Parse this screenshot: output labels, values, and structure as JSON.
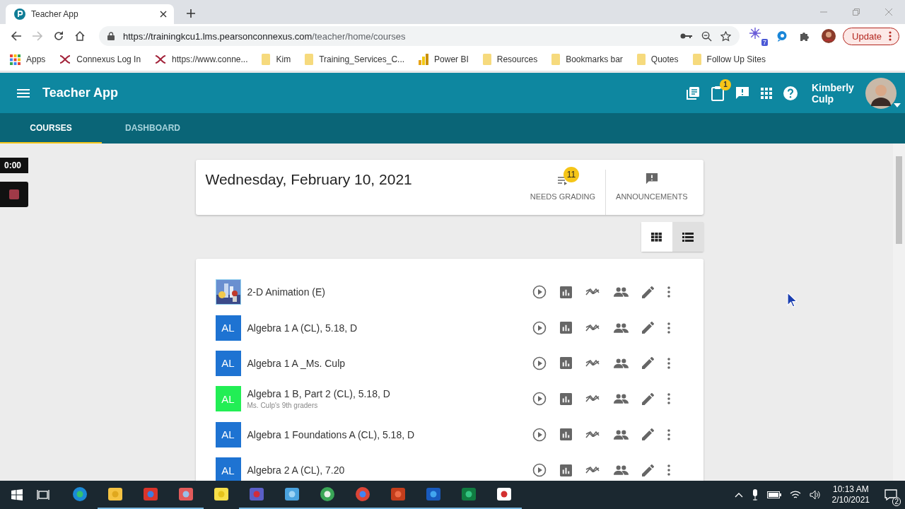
{
  "browser": {
    "tab_title": "Teacher App",
    "url": {
      "host": "https://trainingkcu1.lms.pearsonconnexus.com",
      "path": "/teacher/home/courses"
    },
    "extension_badge": "7",
    "update_button": "Update",
    "bookmarks": [
      {
        "kind": "apps",
        "label": "Apps"
      },
      {
        "kind": "connexus",
        "label": "Connexus Log In"
      },
      {
        "kind": "connexus",
        "label": "https://www.conne..."
      },
      {
        "kind": "folder",
        "label": "Kim"
      },
      {
        "kind": "folder",
        "label": "Training_Services_C..."
      },
      {
        "kind": "powerbi",
        "label": "Power BI"
      },
      {
        "kind": "folder",
        "label": "Resources"
      },
      {
        "kind": "folder",
        "label": "Bookmarks bar"
      },
      {
        "kind": "folder",
        "label": "Quotes"
      },
      {
        "kind": "folder",
        "label": "Follow Up Sites"
      }
    ]
  },
  "app": {
    "title": "Teacher App",
    "notification_badge": "1",
    "user_name": "Kimberly Culp",
    "nav_tabs": [
      {
        "label": "COURSES",
        "selected": true
      },
      {
        "label": "DASHBOARD",
        "selected": false
      }
    ]
  },
  "recorder": {
    "time": "0:00"
  },
  "summary": {
    "date": "Wednesday, February 10, 2021",
    "needs_grading": {
      "count": "11",
      "label": "NEEDS GRADING"
    },
    "announcements": {
      "label": "ANNOUNCEMENTS"
    }
  },
  "view_toggle": [
    {
      "kind": "grid",
      "selected": false
    },
    {
      "kind": "list",
      "selected": true
    }
  ],
  "courses": [
    {
      "name": "2-D Animation (E)"
    },
    {
      "name": "Algebra 1 A (CL), 5.18, D",
      "thumb": {
        "kind": "initials",
        "text": "AL",
        "color": "#1e73d2"
      }
    },
    {
      "name": "Algebra 1 A _Ms. Culp",
      "thumb": {
        "kind": "initials",
        "text": "AL",
        "color": "#1e73d2"
      }
    },
    {
      "name": "Algebra 1 B, Part 2 (CL), 5.18, D",
      "subtitle": "Ms. Culp's 9th graders",
      "thumb": {
        "kind": "initials",
        "text": "AL",
        "color": "#22ee55"
      }
    },
    {
      "name": "Algebra 1 Foundations A (CL), 5.18, D",
      "thumb": {
        "kind": "initials",
        "text": "AL",
        "color": "#1e73d2"
      }
    },
    {
      "name": "Algebra 2 A (CL), 7.20",
      "thumb": {
        "kind": "initials",
        "text": "AL",
        "color": "#1e73d2"
      }
    }
  ],
  "taskbar": {
    "apps": [
      {
        "kind": "edge",
        "running": false
      },
      {
        "kind": "folder",
        "running": true
      },
      {
        "kind": "snip",
        "running": true
      },
      {
        "kind": "sketch",
        "running": true
      },
      {
        "kind": "notes",
        "running": false
      },
      {
        "kind": "teams",
        "running": true
      },
      {
        "kind": "photos",
        "running": true
      },
      {
        "kind": "globe",
        "running": true
      },
      {
        "kind": "chrome",
        "running": true
      },
      {
        "kind": "powerpoint",
        "running": true
      },
      {
        "kind": "word",
        "running": true
      },
      {
        "kind": "excel",
        "running": true
      },
      {
        "kind": "pdf",
        "running": true
      }
    ],
    "time": "10:13 AM",
    "date": "2/10/2021",
    "notifications": "2"
  }
}
